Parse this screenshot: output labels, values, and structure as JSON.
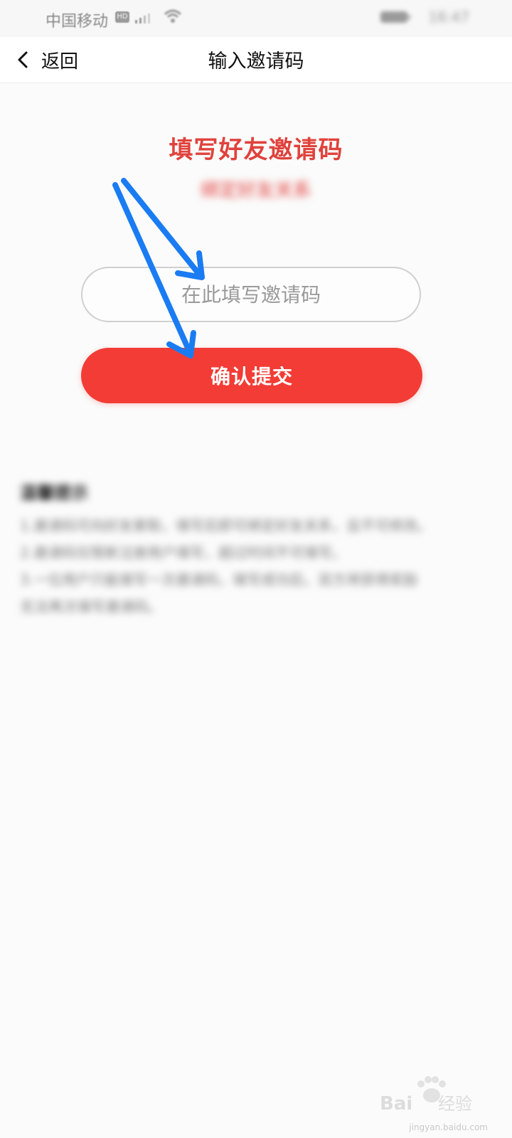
{
  "status_bar": {
    "carrier": "中国移动",
    "hd": "HD",
    "time": "16:47"
  },
  "nav": {
    "back_label": "返回",
    "title": "输入邀请码"
  },
  "main": {
    "headline": "填写好友邀请码",
    "subheadline": "绑定好友关系",
    "input_placeholder": "在此填写邀请码",
    "input_value": "",
    "submit_label": "确认提交"
  },
  "notes": {
    "title": "温馨提示",
    "lines": [
      "1.邀请码可向好友索取，填写后即可绑定好友关系，且不可修改。",
      "2.邀请码仅限新注册用户填写，超过时间不可填写。",
      "3.一位用户只能填写一次邀请码，填写成功后，双方将获得奖励",
      "无法再次填写邀请码。"
    ]
  },
  "watermark": {
    "brand": "Baidu经验",
    "url": "jingyan.baidu.com"
  },
  "colors": {
    "accent": "#f23c35",
    "headline": "#e0423c",
    "annotation_arrow": "#1a7cf2"
  },
  "icons": {
    "back": "chevron-left-icon",
    "signal": "signal-icon",
    "wifi": "wifi-icon",
    "battery": "battery-icon"
  }
}
